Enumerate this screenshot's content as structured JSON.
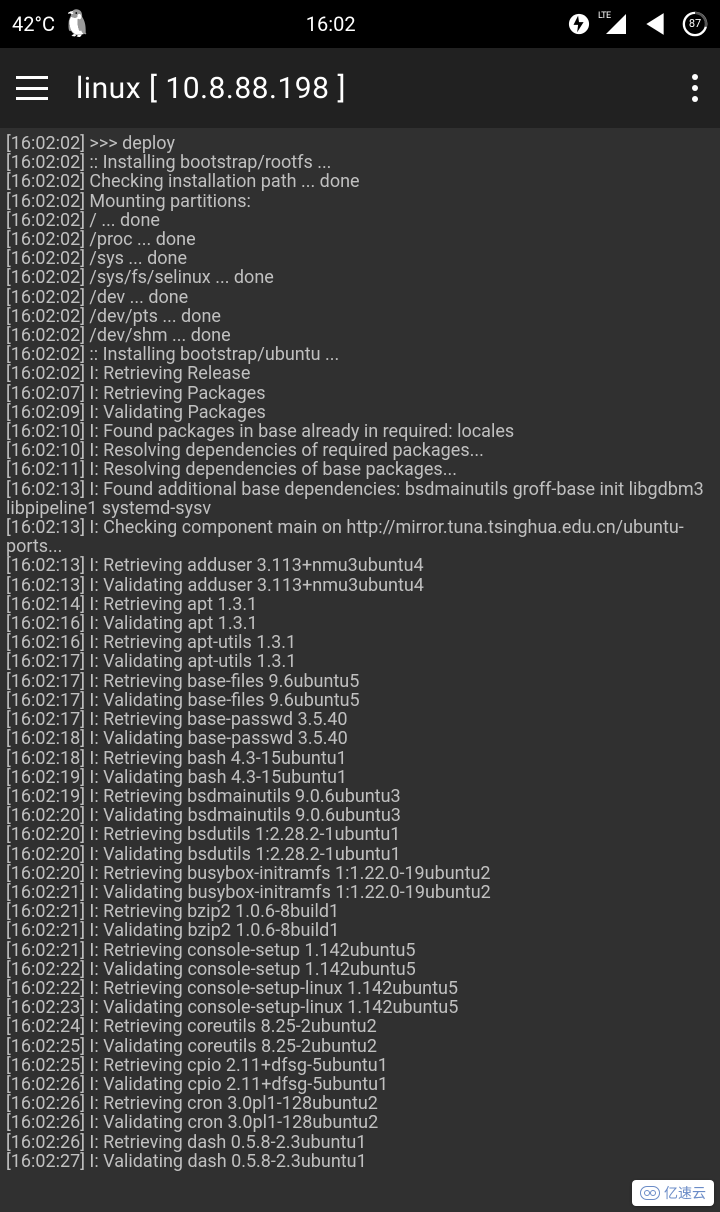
{
  "status": {
    "temperature": "42°C",
    "time": "16:02",
    "battery": "87"
  },
  "app": {
    "title": "linux  [ 10.8.88.198 ]"
  },
  "log": [
    "[16:02:02] >>> deploy",
    "[16:02:02] :: Installing bootstrap/rootfs ...",
    "[16:02:02] Checking installation path ... done",
    "[16:02:02] Mounting partitions:",
    "[16:02:02] / ... done",
    "[16:02:02] /proc ... done",
    "[16:02:02] /sys ... done",
    "[16:02:02] /sys/fs/selinux ... done",
    "[16:02:02] /dev ... done",
    "[16:02:02] /dev/pts ... done",
    "[16:02:02] /dev/shm ... done",
    "[16:02:02] :: Installing bootstrap/ubuntu ...",
    "[16:02:02] I: Retrieving Release",
    "[16:02:07] I: Retrieving Packages",
    "[16:02:09] I: Validating Packages",
    "[16:02:10] I: Found packages in base already in required: locales",
    "[16:02:10] I: Resolving dependencies of required packages...",
    "[16:02:11] I: Resolving dependencies of base packages...",
    "[16:02:13] I: Found additional base dependencies: bsdmainutils groff-base init libgdbm3 libpipeline1 systemd-sysv",
    "[16:02:13] I: Checking component main on http://mirror.tuna.tsinghua.edu.cn/ubuntu-ports...",
    "[16:02:13] I: Retrieving adduser 3.113+nmu3ubuntu4",
    "[16:02:13] I: Validating adduser 3.113+nmu3ubuntu4",
    "[16:02:14] I: Retrieving apt 1.3.1",
    "[16:02:16] I: Validating apt 1.3.1",
    "[16:02:16] I: Retrieving apt-utils 1.3.1",
    "[16:02:17] I: Validating apt-utils 1.3.1",
    "[16:02:17] I: Retrieving base-files 9.6ubuntu5",
    "[16:02:17] I: Validating base-files 9.6ubuntu5",
    "[16:02:17] I: Retrieving base-passwd 3.5.40",
    "[16:02:18] I: Validating base-passwd 3.5.40",
    "[16:02:18] I: Retrieving bash 4.3-15ubuntu1",
    "[16:02:19] I: Validating bash 4.3-15ubuntu1",
    "[16:02:19] I: Retrieving bsdmainutils 9.0.6ubuntu3",
    "[16:02:20] I: Validating bsdmainutils 9.0.6ubuntu3",
    "[16:02:20] I: Retrieving bsdutils 1:2.28.2-1ubuntu1",
    "[16:02:20] I: Validating bsdutils 1:2.28.2-1ubuntu1",
    "[16:02:20] I: Retrieving busybox-initramfs 1:1.22.0-19ubuntu2",
    "[16:02:21] I: Validating busybox-initramfs 1:1.22.0-19ubuntu2",
    "[16:02:21] I: Retrieving bzip2 1.0.6-8build1",
    "[16:02:21] I: Validating bzip2 1.0.6-8build1",
    "[16:02:21] I: Retrieving console-setup 1.142ubuntu5",
    "[16:02:22] I: Validating console-setup 1.142ubuntu5",
    "[16:02:22] I: Retrieving console-setup-linux 1.142ubuntu5",
    "[16:02:23] I: Validating console-setup-linux 1.142ubuntu5",
    "[16:02:24] I: Retrieving coreutils 8.25-2ubuntu2",
    "[16:02:25] I: Validating coreutils 8.25-2ubuntu2",
    "[16:02:25] I: Retrieving cpio 2.11+dfsg-5ubuntu1",
    "[16:02:26] I: Validating cpio 2.11+dfsg-5ubuntu1",
    "[16:02:26] I: Retrieving cron 3.0pl1-128ubuntu2",
    "[16:02:26] I: Validating cron 3.0pl1-128ubuntu2",
    "[16:02:26] I: Retrieving dash 0.5.8-2.3ubuntu1",
    "[16:02:27] I: Validating dash 0.5.8-2.3ubuntu1"
  ],
  "watermark": "亿速云"
}
